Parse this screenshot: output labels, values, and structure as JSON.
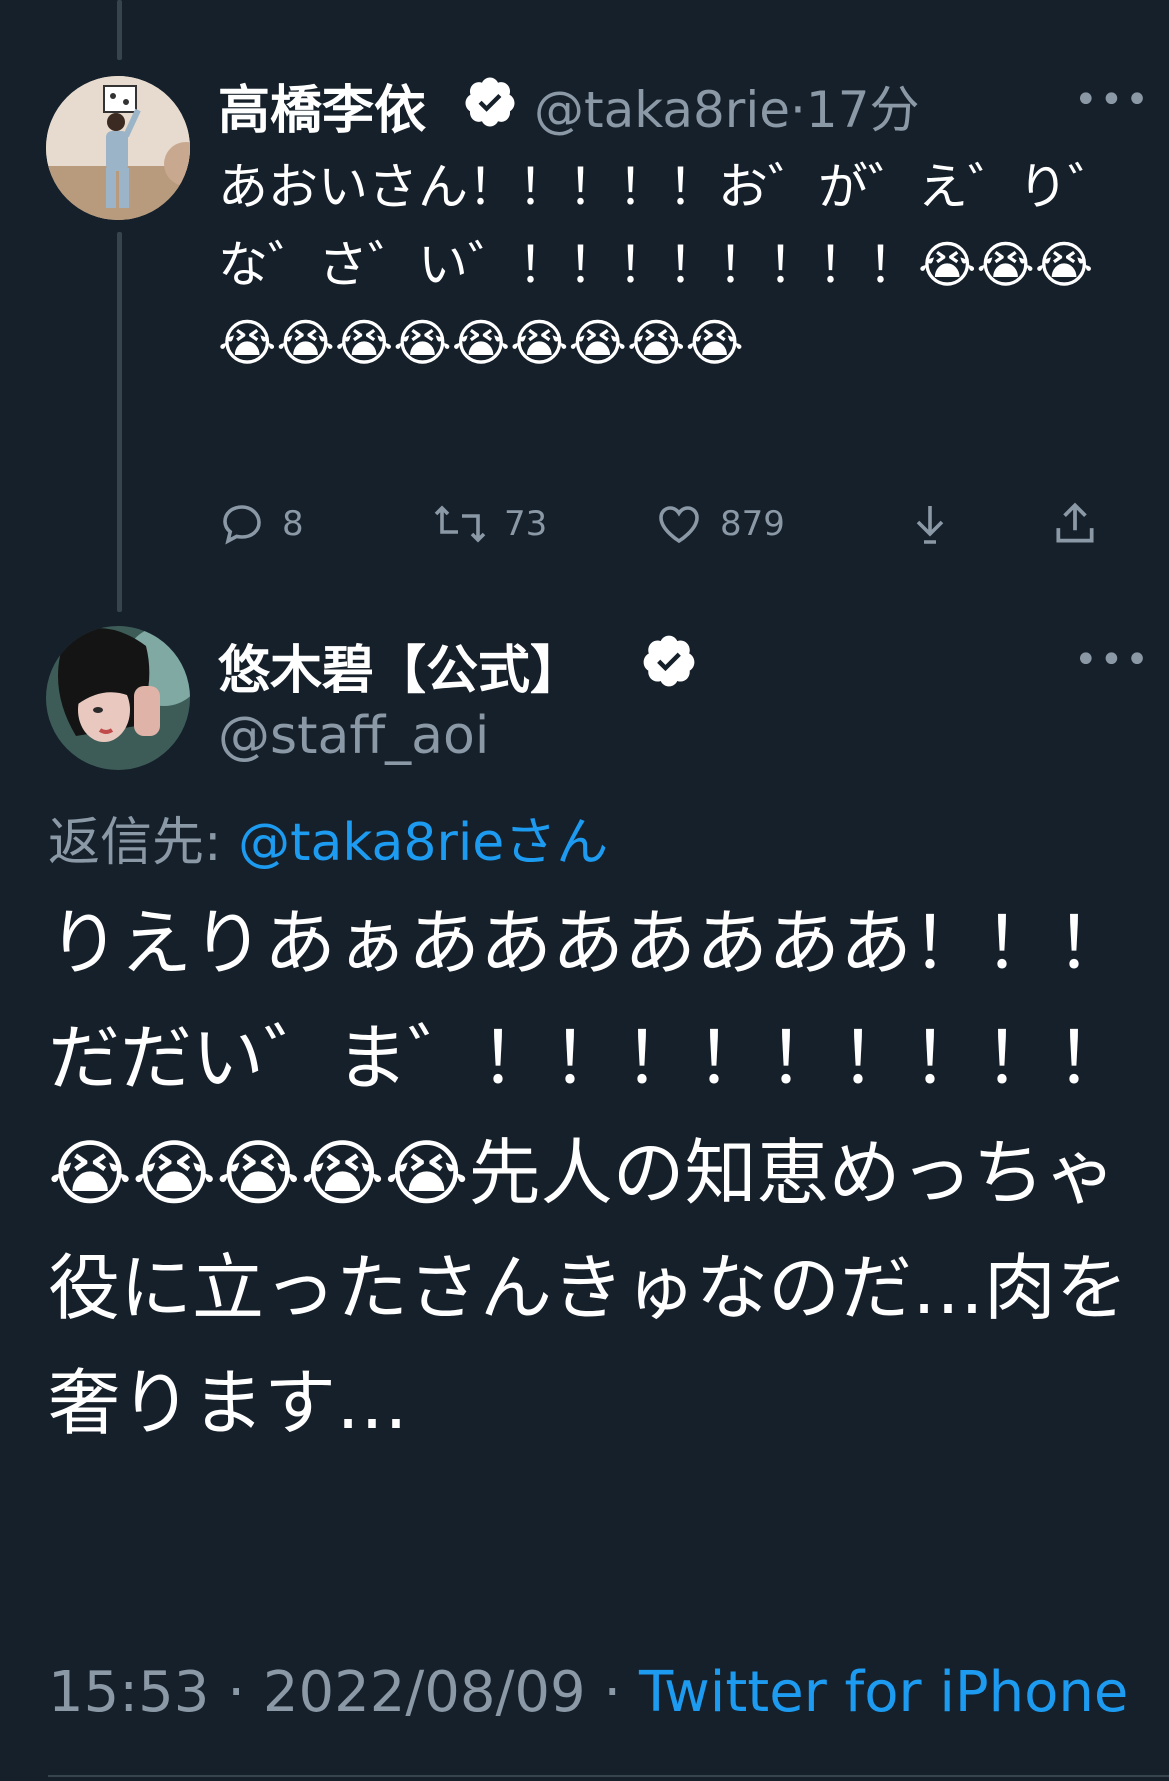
{
  "reply_tweet": {
    "display_name": "高橋李依",
    "handle": "@taka8rie",
    "separator": "·",
    "time": "17分",
    "text": "あおいさん！！！！！お゛が゛え゛り゛な゛さ゛い゛！！！！！！！！😭😭😭😭😭😭😭😭😭😭😭😭",
    "stats": {
      "replies": "8",
      "retweets": "73",
      "likes": "879"
    }
  },
  "main_tweet": {
    "display_name": "悠木碧【公式】",
    "handle": "@staff_aoi",
    "reply_to_label": "返信先:",
    "reply_to_handle": "@taka8rieさん",
    "text": "りえりあぁあああああああ！！！だだい゛ま゛！！！！！！！！！😭😭😭😭😭先人の知恵めっちゃ役に立ったさんきゅなのだ…肉を奢ります…",
    "time": "15:53",
    "date": "2022/08/09",
    "meta_separator": "·",
    "source": "Twitter for iPhone"
  },
  "colors": {
    "background": "#15202b",
    "secondary_text": "#8b98a5",
    "link": "#1d9bf0",
    "thread_line": "#38444d"
  },
  "icons": {
    "verified": "verified-badge-icon",
    "more": "more-horizontal-icon",
    "reply": "reply-bubble-icon",
    "retweet": "retweet-icon",
    "like": "heart-icon",
    "bookmark": "download-arrow-icon",
    "share": "share-icon"
  }
}
